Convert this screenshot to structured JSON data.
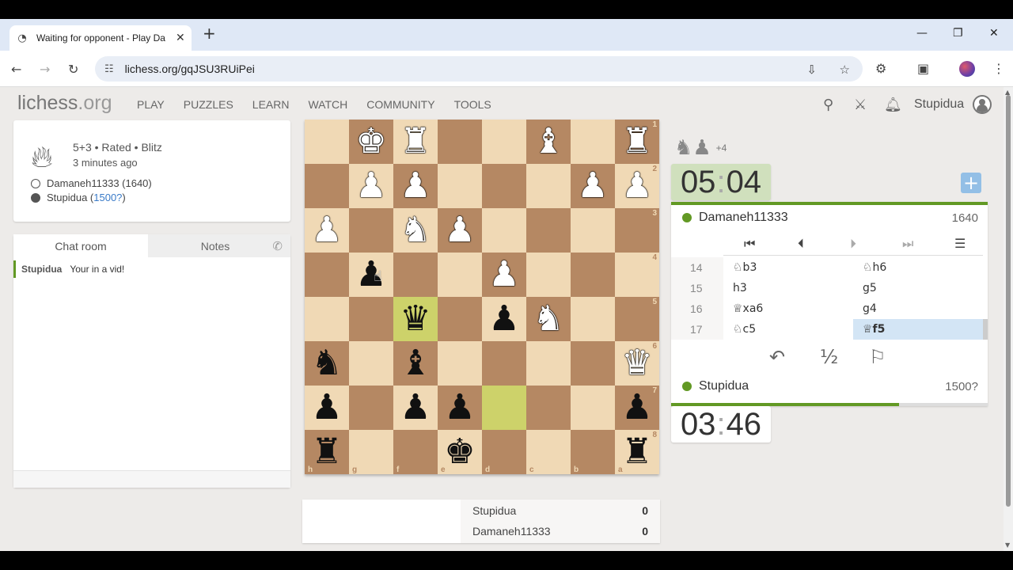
{
  "browser": {
    "tab_title": "Waiting for opponent - Play Da",
    "url": "lichess.org/gqJSU3RUiPei"
  },
  "site": {
    "logo_main": "lichess",
    "logo_tld": ".org",
    "nav": [
      "PLAY",
      "PUZZLES",
      "LEARN",
      "WATCH",
      "COMMUNITY",
      "TOOLS"
    ],
    "username": "Stupidua"
  },
  "game_meta": {
    "setup": "5+3 • Rated • Blitz",
    "time_ago": "3 minutes ago",
    "white_player": "Damaneh11333 (1640)",
    "black_player_name": "Stupidua (",
    "black_player_rating": "1500?",
    "black_player_close": ")"
  },
  "chat": {
    "tabs": [
      "Chat room",
      "Notes"
    ],
    "messages": [
      {
        "user": "Stupidua",
        "text": "Your in a vid!"
      }
    ]
  },
  "board": {
    "orientation": "black",
    "rank_labels": [
      "1",
      "2",
      "3",
      "4",
      "5",
      "6",
      "7",
      "8"
    ],
    "file_labels": [
      "h",
      "g",
      "f",
      "e",
      "d",
      "c",
      "b",
      "a"
    ],
    "rows": [
      [
        "",
        "wK",
        "wR",
        "",
        "",
        "wB",
        "",
        "wR"
      ],
      [
        "",
        "wP",
        "wP",
        "",
        "",
        "",
        "wP",
        "wP"
      ],
      [
        "wP",
        "",
        "wN",
        "wP",
        "",
        "",
        "",
        ""
      ],
      [
        "",
        "bP",
        "",
        "",
        "wP",
        "",
        "",
        ""
      ],
      [
        "",
        "",
        "bQ",
        "",
        "bP",
        "wN",
        "",
        ""
      ],
      [
        "bN",
        "",
        "bB",
        "",
        "",
        "",
        "",
        "wQ"
      ],
      [
        "bP",
        "",
        "bP",
        "bP",
        "",
        "",
        "",
        "bP"
      ],
      [
        "bR",
        "",
        "",
        "bK",
        "",
        "",
        "",
        "bR"
      ]
    ],
    "highlight": [
      "4-2",
      "6-4"
    ]
  },
  "crosstable": [
    {
      "name": "Stupidua",
      "score": "0"
    },
    {
      "name": "Damaneh11333",
      "score": "0"
    }
  ],
  "material": {
    "pieces": [
      "♞",
      "♟"
    ],
    "diff": "+4"
  },
  "clocks": {
    "top": {
      "min": "05",
      "sec": "04"
    },
    "bottom": {
      "min": "03",
      "sec": "46"
    }
  },
  "players": {
    "top": {
      "name": "Damaneh11333",
      "rating": "1640"
    },
    "bottom": {
      "name": "Stupidua",
      "rating": "1500?"
    }
  },
  "moves": [
    {
      "n": "14",
      "w": "♘b3",
      "b": "♘h6"
    },
    {
      "n": "15",
      "w": "h3",
      "b": "g5"
    },
    {
      "n": "16",
      "w": "♕xa6",
      "b": "g4"
    },
    {
      "n": "17",
      "w": "♘c5",
      "b": "♕f5"
    }
  ],
  "time_progress": {
    "top": 1.0,
    "bottom": 0.72
  },
  "colors": {
    "accent": "#629924",
    "board_light": "#f0d9b5",
    "board_dark": "#b58863",
    "highlight": "#cdd26a"
  }
}
